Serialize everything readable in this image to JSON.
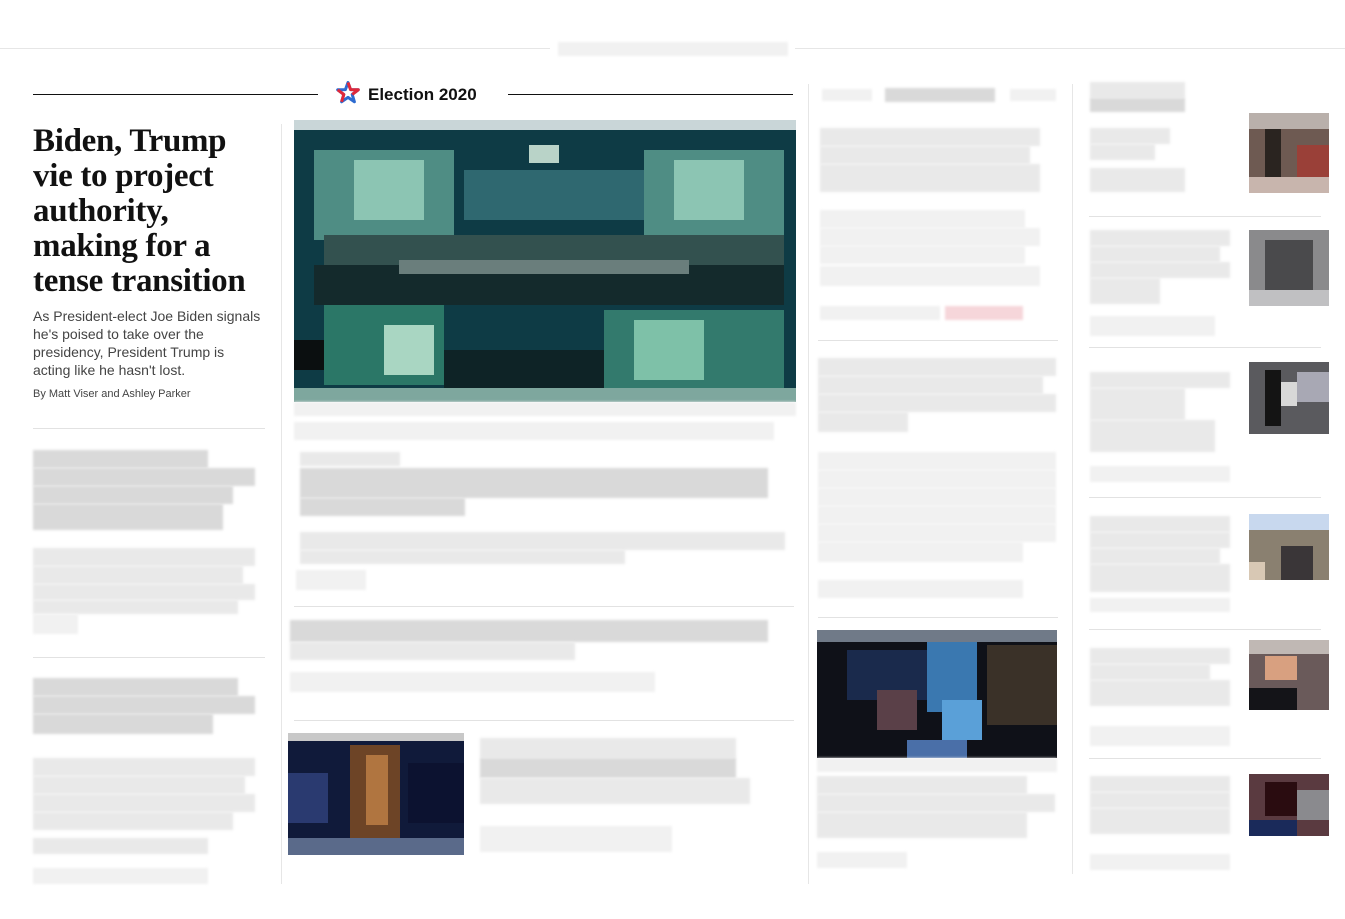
{
  "section": {
    "icon": "election-star-icon",
    "title": "Election 2020",
    "colors": {
      "icon_red": "#e0283a",
      "icon_blue": "#2d6bd0",
      "rule": "#111111"
    }
  },
  "lead_story": {
    "headline": "Biden, Trump vie to project authority, making for a tense transition",
    "dek": "As President-elect Joe Biden signals he's poised to take over the presidency, President Trump is acting like he hasn't lost.",
    "byline": "By Matt Viser and Ashley Parker"
  }
}
